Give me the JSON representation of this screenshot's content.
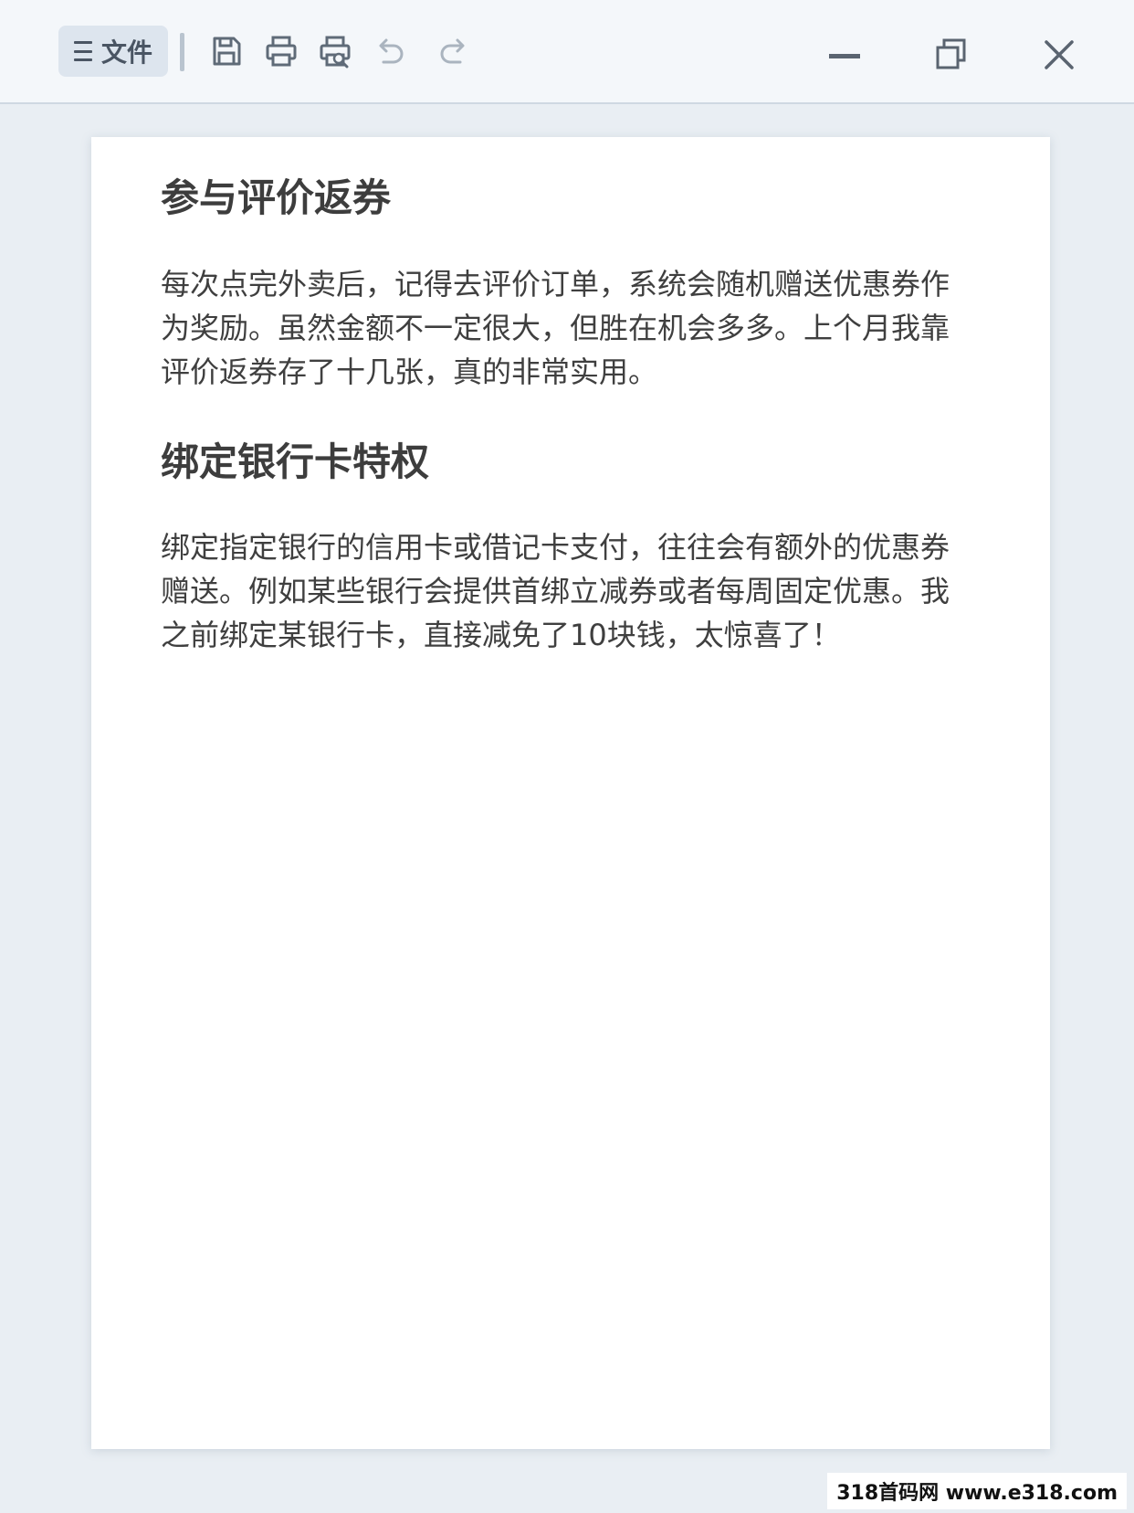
{
  "toolbar": {
    "file_label": "文件",
    "icons": [
      "menu-icon",
      "save-icon",
      "print-icon",
      "print-preview-icon",
      "undo-icon",
      "redo-icon"
    ],
    "window_controls": [
      "minimize-icon",
      "restore-icon",
      "close-icon"
    ]
  },
  "document": {
    "sections": [
      {
        "title": "参与评价返券",
        "body": "每次点完外卖后，记得去评价订单，系统会随机赠送优惠券作为奖励。虽然金额不一定很大，但胜在机会多多。上个月我靠评价返券存了十几张，真的非常实用。"
      },
      {
        "title": "绑定银行卡特权",
        "body": "绑定指定银行的信用卡或借记卡支付，往往会有额外的优惠券赠送。例如某些银行会提供首绑立减券或者每周固定优惠。我之前绑定某银行卡，直接减免了10块钱，太惊喜了！"
      }
    ]
  },
  "watermark": "318首码网 www.e318.com",
  "colors": {
    "toolbar_bg": "#f4f7fa",
    "window_bg": "#e9eef3",
    "page_bg": "#ffffff",
    "text": "#3f3f3f",
    "icon": "#5f6b78"
  }
}
